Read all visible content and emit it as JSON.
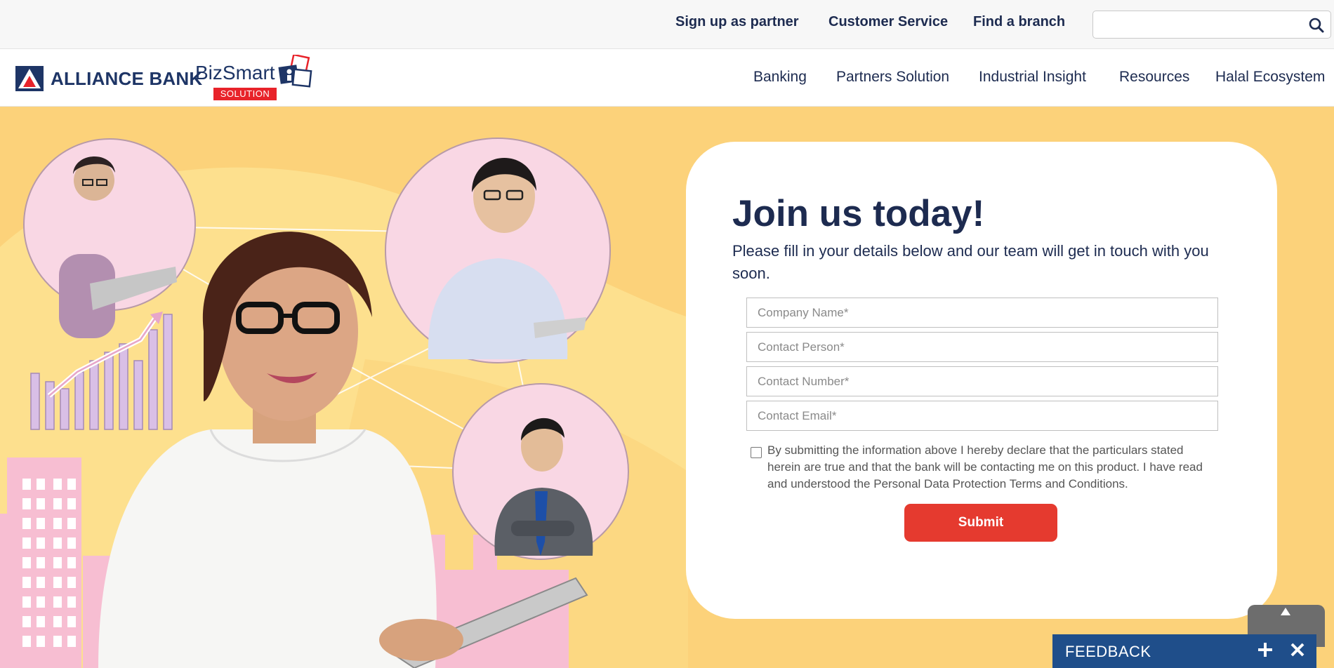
{
  "topbar": {
    "links": [
      "Sign up as partner",
      "Customer Service",
      "Find a branch"
    ],
    "search_value": ""
  },
  "brand": {
    "bank_name": "ALLIANCE BANK",
    "product_name": "BizSmart",
    "product_tag": "SOLUTION"
  },
  "nav": {
    "items": [
      "Banking",
      "Partners Solution",
      "Industrial Insight",
      "Resources",
      "Halal Ecosystem"
    ]
  },
  "form": {
    "title": "Join us today!",
    "subtitle": "Please fill in your details below and our team will get in touch with you soon.",
    "fields": [
      {
        "placeholder": "Company Name*",
        "value": ""
      },
      {
        "placeholder": "Contact Person*",
        "value": ""
      },
      {
        "placeholder": "Contact Number*",
        "value": ""
      },
      {
        "placeholder": "Contact Email*",
        "value": ""
      }
    ],
    "consent_checked": false,
    "consent_text": "By submitting the information above I hereby declare that the particulars stated herein are true and that the bank will be contacting me on this product. I have read and understood the Personal Data Protection Terms and Conditions.",
    "submit_label": "Submit"
  },
  "feedback": {
    "label": "FEEDBACK"
  },
  "colors": {
    "navy": "#1d2b50",
    "brand_red": "#e8232a",
    "hero_yellow": "#fcd27a",
    "submit_red": "#e53a2f",
    "feedback_blue": "#1f4e8a"
  },
  "icons": {
    "search": "search-icon",
    "scroll_top": "arrow-up-icon",
    "feedback_expand": "plus-icon",
    "feedback_close": "close-icon"
  }
}
